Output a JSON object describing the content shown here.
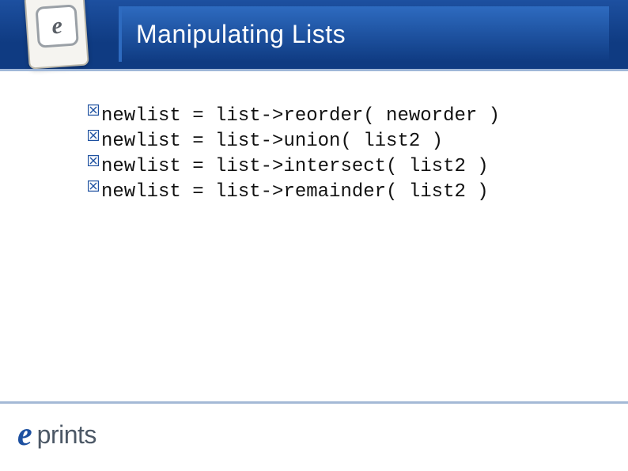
{
  "header": {
    "title": "Manipulating Lists",
    "icon_letter": "e"
  },
  "content": {
    "lines": [
      "newlist = list->reorder( neworder )",
      "newlist = list->union( list2 )",
      "newlist = list->intersect( list2 )",
      "newlist = list->remainder( list2 )"
    ]
  },
  "footer": {
    "logo_e": "e",
    "logo_text": "prints"
  }
}
